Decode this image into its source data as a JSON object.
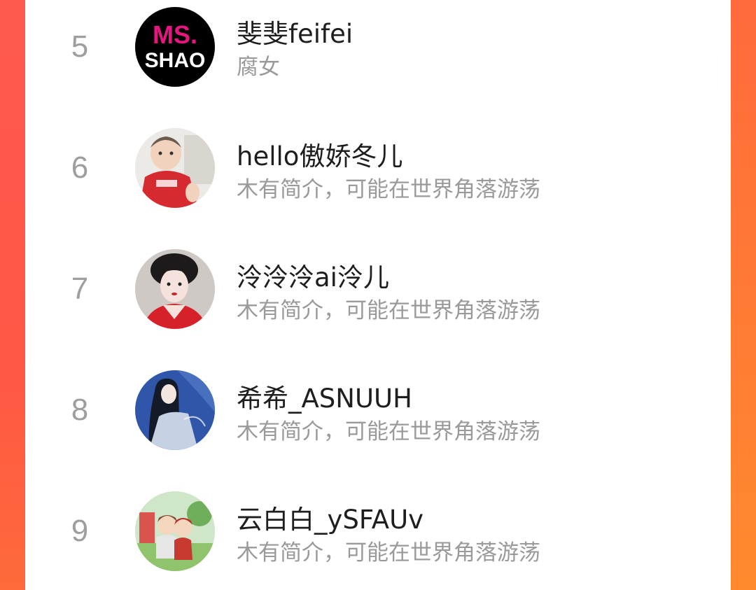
{
  "ranking": {
    "items": [
      {
        "rank": "5",
        "name": "斐斐feifei",
        "desc": "腐女",
        "avatar": "ms-shao-logo-avatar",
        "logo_top": "MS.",
        "logo_bottom": "SHAO"
      },
      {
        "rank": "6",
        "name": "hello傲娇冬儿",
        "desc": "木有简介，可能在世界角落游荡",
        "avatar": "baby-photo-avatar"
      },
      {
        "rank": "7",
        "name": "泠泠泠ai泠儿",
        "desc": "木有简介，可能在世界角落游荡",
        "avatar": "woman-portrait-avatar"
      },
      {
        "rank": "8",
        "name": "希希_ASNUUH",
        "desc": "木有简介，可能在世界角落游荡",
        "avatar": "anime-girl-avatar"
      },
      {
        "rank": "9",
        "name": "云白白_ySFAUv",
        "desc": "木有简介，可能在世界角落游荡",
        "avatar": "cartoon-couple-avatar"
      }
    ]
  },
  "colors": {
    "side_left": "#ff5a4e",
    "side_right": "#ff7a35",
    "rank_text": "#9e9e9e",
    "name_text": "#1e1e1e",
    "desc_text": "#9a9a9a",
    "logo_accent": "#e6167f"
  }
}
